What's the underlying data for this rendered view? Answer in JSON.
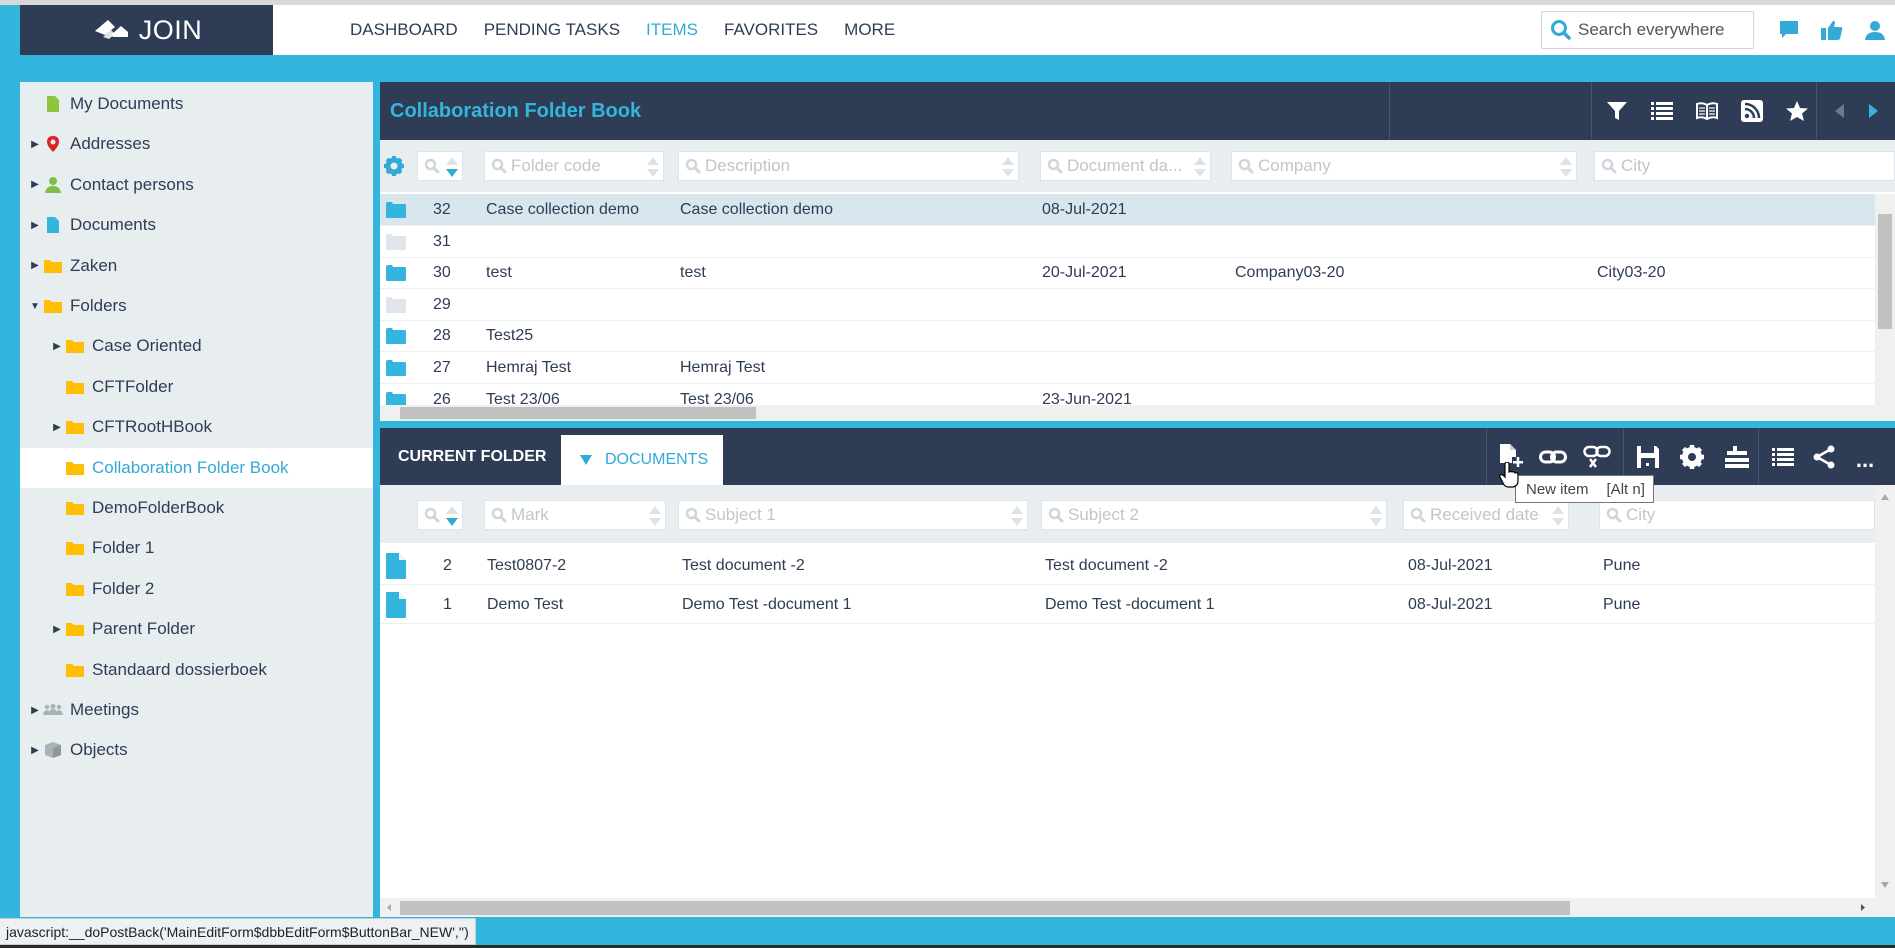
{
  "app": {
    "logo_text": "JOIN",
    "nav": [
      {
        "label": "DASHBOARD",
        "active": false
      },
      {
        "label": "PENDING TASKS",
        "active": false
      },
      {
        "label": "ITEMS",
        "active": true
      },
      {
        "label": "FAVORITES",
        "active": false
      },
      {
        "label": "MORE",
        "active": false
      }
    ],
    "search_placeholder": "Search everywhere",
    "top_icons": [
      "chat-icon",
      "thumbs-up-icon",
      "user-icon"
    ]
  },
  "colors": {
    "accent": "#33b5dd",
    "header_dark": "#2e3d55",
    "sidebar_bg": "#e8edf0",
    "selected_row": "#d7e7ed",
    "folder_yellow": "#ffc107",
    "folder_blue": "#33b5dd"
  },
  "sidebar": {
    "items": [
      {
        "label": "My Documents",
        "icon": "document-green-icon",
        "level": 0,
        "arrow": "none"
      },
      {
        "label": "Addresses",
        "icon": "map-pin-icon",
        "level": 0,
        "arrow": "collapsed"
      },
      {
        "label": "Contact persons",
        "icon": "person-icon",
        "level": 0,
        "arrow": "collapsed"
      },
      {
        "label": "Documents",
        "icon": "document-blue-icon",
        "level": 0,
        "arrow": "collapsed"
      },
      {
        "label": "Zaken",
        "icon": "folder-icon",
        "level": 0,
        "arrow": "collapsed"
      },
      {
        "label": "Folders",
        "icon": "folder-icon",
        "level": 0,
        "arrow": "expanded"
      },
      {
        "label": "Case Oriented",
        "icon": "folder-icon",
        "level": 1,
        "arrow": "collapsed"
      },
      {
        "label": "CFTFolder",
        "icon": "folder-icon",
        "level": 1,
        "arrow": "none"
      },
      {
        "label": "CFTRootHBook",
        "icon": "folder-icon",
        "level": 1,
        "arrow": "collapsed"
      },
      {
        "label": "Collaboration Folder Book",
        "icon": "folder-icon",
        "level": 1,
        "arrow": "none",
        "selected": true
      },
      {
        "label": "DemoFolderBook",
        "icon": "folder-icon",
        "level": 1,
        "arrow": "none"
      },
      {
        "label": "Folder 1",
        "icon": "folder-icon",
        "level": 1,
        "arrow": "none"
      },
      {
        "label": "Folder 2",
        "icon": "folder-icon",
        "level": 1,
        "arrow": "none"
      },
      {
        "label": "Parent Folder",
        "icon": "folder-icon",
        "level": 1,
        "arrow": "collapsed"
      },
      {
        "label": "Standaard dossierboek",
        "icon": "folder-icon",
        "level": 1,
        "arrow": "none"
      },
      {
        "label": "Meetings",
        "icon": "people-icon",
        "level": 0,
        "arrow": "collapsed"
      },
      {
        "label": "Objects",
        "icon": "cube-icon",
        "level": 0,
        "arrow": "collapsed"
      }
    ]
  },
  "top_panel": {
    "title": "Collaboration Folder Book",
    "toolbar": [
      "filter-icon",
      "list-icon",
      "book-icon",
      "rss-icon",
      "star-icon"
    ],
    "filters": {
      "id": "",
      "folder_code": "Folder code",
      "description": "Description",
      "document_date": "Document da...",
      "company": "Company",
      "city": "City"
    },
    "rows": [
      {
        "id": "32",
        "folder_code": "Case collection demo",
        "description": "Case collection demo",
        "document_date": "08-Jul-2021",
        "company": "",
        "city": "",
        "active": true,
        "selected": true
      },
      {
        "id": "31",
        "folder_code": "",
        "description": "",
        "document_date": "",
        "company": "",
        "city": "",
        "active": false
      },
      {
        "id": "30",
        "folder_code": "test",
        "description": "test",
        "document_date": "20-Jul-2021",
        "company": "Company03-20",
        "city": "City03-20",
        "active": true
      },
      {
        "id": "29",
        "folder_code": "",
        "description": "",
        "document_date": "",
        "company": "",
        "city": "",
        "active": false
      },
      {
        "id": "28",
        "folder_code": "Test25",
        "description": "",
        "document_date": "",
        "company": "",
        "city": "",
        "active": true
      },
      {
        "id": "27",
        "folder_code": "Hemraj Test",
        "description": "Hemraj Test",
        "document_date": "",
        "company": "",
        "city": "",
        "active": true
      },
      {
        "id": "26",
        "folder_code": "Test 23/06",
        "description": "Test 23/06",
        "document_date": "23-Jun-2021",
        "company": "",
        "city": "",
        "active": true
      }
    ]
  },
  "bottom_panel": {
    "tab_current": "CURRENT FOLDER",
    "tab_documents": "DOCUMENTS",
    "toolbar": [
      "new-item-icon",
      "link-icon",
      "unlink-icon",
      "save-icon",
      "gear-icon",
      "align-icon",
      "list-icon",
      "share-icon",
      "more-icon"
    ],
    "more_label": "...",
    "tooltip": {
      "label": "New item",
      "shortcut": "[Alt n]"
    },
    "filters": {
      "id": "",
      "mark": "Mark",
      "subject1": "Subject 1",
      "subject2": "Subject 2",
      "received_date": "Received date",
      "city": "City"
    },
    "rows": [
      {
        "id": "2",
        "mark": "Test0807-2",
        "subject1": "Test document -2",
        "subject2": "Test document -2",
        "received_date": "08-Jul-2021",
        "city": "Pune"
      },
      {
        "id": "1",
        "mark": "Demo Test",
        "subject1": "Demo Test -document 1",
        "subject2": "Demo Test -document 1",
        "received_date": "08-Jul-2021",
        "city": "Pune"
      }
    ]
  },
  "status_bar": {
    "text": "javascript:__doPostBack('MainEditForm$dbbEditForm$ButtonBar_NEW','')"
  }
}
